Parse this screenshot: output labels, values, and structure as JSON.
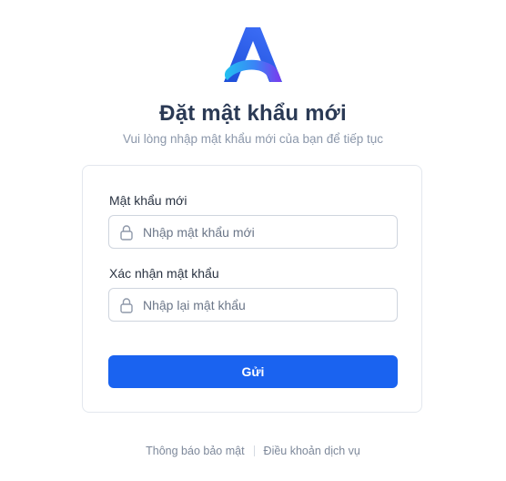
{
  "brand": {
    "logo_icon": "brand-a-logo-icon",
    "gradient_start": "#1d4ed8",
    "gradient_mid": "#2563eb",
    "gradient_cyan": "#22c1f0",
    "gradient_purple": "#7c3aed"
  },
  "header": {
    "title": "Đặt mật khẩu mới",
    "subtitle": "Vui lòng nhập mật khẩu mới của bạn để tiếp tục"
  },
  "form": {
    "new_password": {
      "label": "Mật khẩu mới",
      "placeholder": "Nhập mật khẩu mới",
      "value": "",
      "icon": "lock-icon"
    },
    "confirm_password": {
      "label": "Xác nhận mật khẩu",
      "placeholder": "Nhập lại mật khẩu",
      "value": "",
      "icon": "lock-icon"
    },
    "submit_label": "Gửi",
    "accent_color": "#1a63f0"
  },
  "footer": {
    "privacy_link": "Thông báo bảo mật",
    "terms_link": "Điều khoản dịch vụ"
  }
}
